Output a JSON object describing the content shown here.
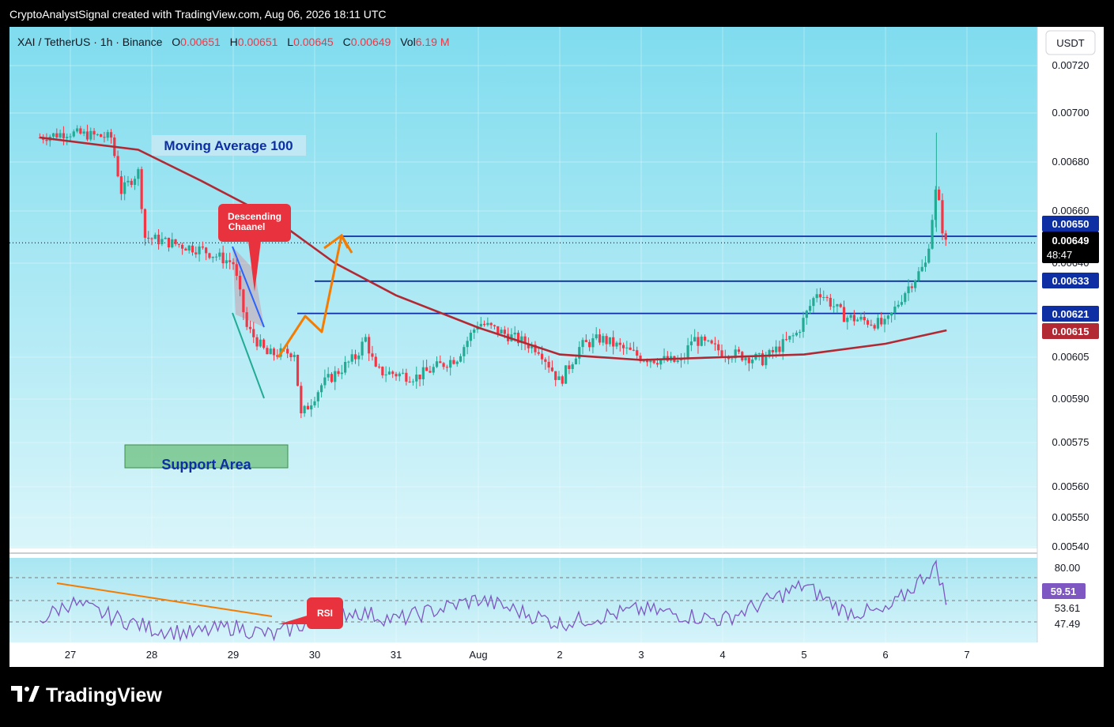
{
  "header": {
    "credit": "CryptoAnalystSignal created with TradingView.com, Aug 06, 2026 18:11 UTC"
  },
  "legend": {
    "symbol": "XAI / TetherUS · 1h · Binance",
    "o_label": "O",
    "o_value": "0.00651",
    "h_label": "H",
    "h_value": "0.00651",
    "l_label": "L",
    "l_value": "0.00645",
    "c_label": "C",
    "c_value": "0.00649",
    "vol_label": "Vol",
    "vol_value": "6.19 M"
  },
  "currency_button": "USDT",
  "annotations": {
    "ma_label": "Moving Average 100",
    "channel_label_line1": "Descending",
    "channel_label_line2": "Chaanel",
    "support_label": "Support Area",
    "rsi_callout": "RSI"
  },
  "price_badges": {
    "level_650": "0.00650",
    "last_price": "0.00649",
    "countdown": "48:47",
    "level_633": "0.00633",
    "level_621": "0.00621",
    "ma_value": "0.00615"
  },
  "rsi_badges": {
    "current": "59.51"
  },
  "brand": {
    "name": "TradingView"
  },
  "colors": {
    "up": "#22ab94",
    "down": "#f23645",
    "ma": "#b22833",
    "level": "#0d2fa3",
    "channel": "#2962ff",
    "projection": "#f57c00",
    "rsi": "#7e57c2",
    "bg_top": "#7fdcee",
    "bg_bottom": "#d6f4fa"
  },
  "chart_data": [
    {
      "type": "candlestick",
      "title": "XAI / TetherUS · 1h · Binance",
      "y_ticks": [
        "0.00720",
        "0.00700",
        "0.00680",
        "0.00660",
        "0.00640",
        "0.00605",
        "0.00590",
        "0.00575",
        "0.00560",
        "0.00550",
        "0.00540"
      ],
      "x_ticks": [
        "27",
        "28",
        "29",
        "30",
        "31",
        "Aug",
        "2",
        "3",
        "4",
        "5",
        "6",
        "7"
      ],
      "ylim": [
        0.00537,
        0.0073
      ],
      "horizontal_levels": [
        0.0065,
        0.00633,
        0.00621
      ],
      "moving_average": {
        "name": "Moving Average 100",
        "period": 100,
        "last": 0.00615
      },
      "last": {
        "open": 0.00651,
        "high": 0.00651,
        "low": 0.00645,
        "close": 0.00649,
        "volume": "6.19 M"
      },
      "price_path": [
        {
          "x": "26 15:00",
          "y": 0.0069
        },
        {
          "x": "26 23:00",
          "y": 0.00692
        },
        {
          "x": "27 12:00",
          "y": 0.0069
        },
        {
          "x": "27 15:00",
          "y": 0.00668
        },
        {
          "x": "27 20:00",
          "y": 0.00676
        },
        {
          "x": "27 22:00",
          "y": 0.0065
        },
        {
          "x": "28 15:00",
          "y": 0.00645
        },
        {
          "x": "29 00:00",
          "y": 0.0064
        },
        {
          "x": "29 04:00",
          "y": 0.00616
        },
        {
          "x": "29 10:00",
          "y": 0.00606
        },
        {
          "x": "29 18:00",
          "y": 0.00607
        },
        {
          "x": "29 20:00",
          "y": 0.00584
        },
        {
          "x": "30 02:00",
          "y": 0.00595
        },
        {
          "x": "30 12:00",
          "y": 0.00605
        },
        {
          "x": "30 15:00",
          "y": 0.00612
        },
        {
          "x": "30 18:00",
          "y": 0.006
        },
        {
          "x": "31 06:00",
          "y": 0.00598
        },
        {
          "x": "31 18:00",
          "y": 0.00605
        },
        {
          "x": "Aug 1 00:00",
          "y": 0.00618
        },
        {
          "x": "Aug 1 18:00",
          "y": 0.00608
        },
        {
          "x": "Aug 2 00:00",
          "y": 0.00596
        },
        {
          "x": "Aug 2 06:00",
          "y": 0.00609
        },
        {
          "x": "Aug 2 12:00",
          "y": 0.00612
        },
        {
          "x": "Aug 3 00:00",
          "y": 0.00605
        },
        {
          "x": "Aug 3 12:00",
          "y": 0.00603
        },
        {
          "x": "Aug 3 15:00",
          "y": 0.00612
        },
        {
          "x": "Aug 4 00:00",
          "y": 0.00607
        },
        {
          "x": "Aug 4 12:00",
          "y": 0.00604
        },
        {
          "x": "Aug 4 22:00",
          "y": 0.00614
        },
        {
          "x": "Aug 5 04:00",
          "y": 0.0063
        },
        {
          "x": "Aug 5 12:00",
          "y": 0.0062
        },
        {
          "x": "Aug 6 00:00",
          "y": 0.00617
        },
        {
          "x": "Aug 6 06:00",
          "y": 0.0063
        },
        {
          "x": "Aug 6 12:00",
          "y": 0.0064
        },
        {
          "x": "Aug 6 15:00",
          "y": 0.0067
        },
        {
          "x": "Aug 6 17:00",
          "y": 0.00651
        },
        {
          "x": "Aug 6 18:00",
          "y": 0.00649
        }
      ],
      "ma_path": [
        {
          "x": "26 15:00",
          "y": 0.0069
        },
        {
          "x": "27 20:00",
          "y": 0.00685
        },
        {
          "x": "28 15:00",
          "y": 0.00672
        },
        {
          "x": "29 12:00",
          "y": 0.00657
        },
        {
          "x": "30 06:00",
          "y": 0.0064
        },
        {
          "x": "31 00:00",
          "y": 0.00628
        },
        {
          "x": "Aug 1 00:00",
          "y": 0.00616
        },
        {
          "x": "Aug 2 00:00",
          "y": 0.00606
        },
        {
          "x": "Aug 3 00:00",
          "y": 0.00604
        },
        {
          "x": "Aug 4 00:00",
          "y": 0.00605
        },
        {
          "x": "Aug 5 00:00",
          "y": 0.00606
        },
        {
          "x": "Aug 6 00:00",
          "y": 0.0061
        },
        {
          "x": "Aug 6 18:00",
          "y": 0.00615
        }
      ]
    },
    {
      "type": "line",
      "title": "RSI",
      "y_ticks": [
        "80.00",
        "53.61",
        "47.49"
      ],
      "current": 59.51,
      "levels": [
        70,
        50,
        30
      ],
      "values": [
        {
          "x": "26 15:00",
          "y": 50
        },
        {
          "x": "27 00:00",
          "y": 60
        },
        {
          "x": "27 12:00",
          "y": 52
        },
        {
          "x": "28 00:00",
          "y": 45
        },
        {
          "x": "28 12:00",
          "y": 42
        },
        {
          "x": "29 00:00",
          "y": 46
        },
        {
          "x": "29 12:00",
          "y": 41
        },
        {
          "x": "30 00:00",
          "y": 50
        },
        {
          "x": "30 12:00",
          "y": 55
        },
        {
          "x": "31 00:00",
          "y": 50
        },
        {
          "x": "Aug 1 00:00",
          "y": 62
        },
        {
          "x": "Aug 2 00:00",
          "y": 48
        },
        {
          "x": "Aug 3 00:00",
          "y": 56
        },
        {
          "x": "Aug 4 00:00",
          "y": 50
        },
        {
          "x": "Aug 5 00:00",
          "y": 70
        },
        {
          "x": "Aug 5 12:00",
          "y": 55
        },
        {
          "x": "Aug 6 00:00",
          "y": 54
        },
        {
          "x": "Aug 6 15:00",
          "y": 82
        },
        {
          "x": "Aug 6 18:00",
          "y": 59.51
        }
      ]
    }
  ]
}
